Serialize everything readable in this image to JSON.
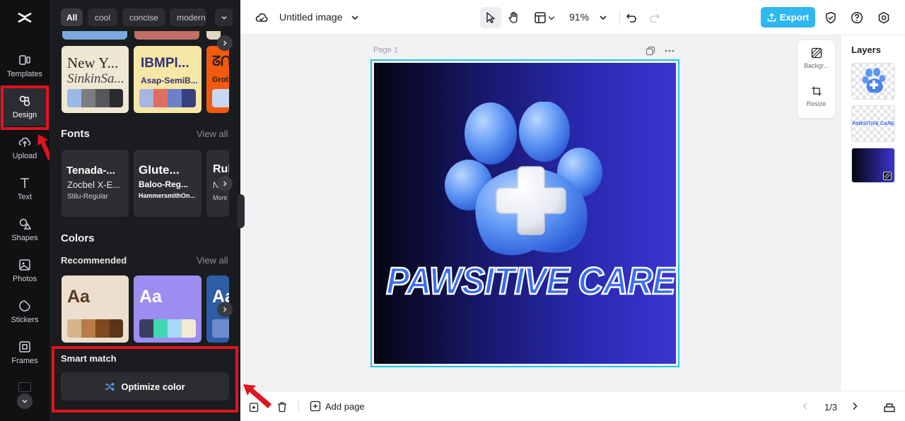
{
  "rail": {
    "items": [
      {
        "label": "Templates",
        "icon": "templates-icon"
      },
      {
        "label": "Design",
        "icon": "design-icon"
      },
      {
        "label": "Upload",
        "icon": "upload-icon"
      },
      {
        "label": "Text",
        "icon": "text-icon"
      },
      {
        "label": "Shapes",
        "icon": "shapes-icon"
      },
      {
        "label": "Photos",
        "icon": "photos-icon"
      },
      {
        "label": "Stickers",
        "icon": "stickers-icon"
      },
      {
        "label": "Frames",
        "icon": "frames-icon"
      }
    ]
  },
  "panel": {
    "chips": [
      "All",
      "cool",
      "concise",
      "modern"
    ],
    "font_pairs": [
      {
        "line1": "New Y...",
        "line2": "SinkinSa..."
      },
      {
        "line1": "IBMPl...",
        "line2": "Asap-SemiB..."
      },
      {
        "line1": "ᘔᑎ",
        "line2": "Grot"
      }
    ],
    "fonts_title": "Fonts",
    "fonts_view_all": "View all",
    "font_cards": [
      {
        "l1": "Tenada-...",
        "l2": "Zocbel X-E...",
        "l3": "Stilu-Regular"
      },
      {
        "l1": "Glute...",
        "l2": "Baloo-Reg...",
        "l3": "HammersmithOn..."
      },
      {
        "l1": "Rul",
        "l2": "N",
        "l3": "Mont"
      }
    ],
    "colors_title": "Colors",
    "recommended_label": "Recommended",
    "colors_view_all": "View all",
    "palette_cards": [
      {
        "sample": "Aa"
      },
      {
        "sample": "Aa"
      },
      {
        "sample": "Aa"
      }
    ],
    "smart_match_title": "Smart match",
    "optimize_label": "Optimize color"
  },
  "topbar": {
    "doc_title": "Untitled image",
    "zoom": "91%",
    "export_label": "Export"
  },
  "canvas": {
    "page_label": "Page 1",
    "headline": "PAWSITIVE CARE"
  },
  "side_tools": {
    "background_label": "Backgr...",
    "resize_label": "Resize"
  },
  "layers": {
    "title": "Layers",
    "text_thumb": "PAWSITIVE CARE"
  },
  "bottombar": {
    "add_page_label": "Add page",
    "page_counter": "1/3"
  },
  "colors": {
    "accent": "#1fb3e8",
    "highlight_red": "#e0141e",
    "canvas_blue": "#3b34d0"
  }
}
